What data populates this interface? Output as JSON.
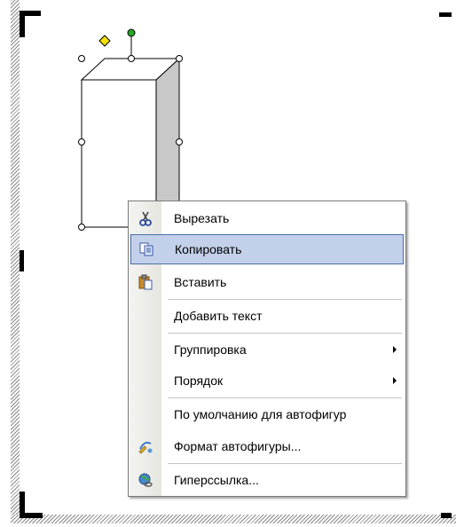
{
  "menu": {
    "items": [
      {
        "label": "Вырезать",
        "icon": "scissors-icon"
      },
      {
        "label": "Копировать",
        "icon": "copy-icon"
      },
      {
        "label": "Вставить",
        "icon": "paste-icon"
      },
      {
        "label": "Добавить текст"
      },
      {
        "label": "Группировка",
        "submenu": true
      },
      {
        "label": "Порядок",
        "submenu": true
      },
      {
        "label": "По умолчанию для автофигур"
      },
      {
        "label": "Формат автофигуры...",
        "icon": "format-shape-icon"
      },
      {
        "label": "Гиперссылка...",
        "icon": "hyperlink-globe-icon"
      }
    ],
    "highlighted_item": "Копировать"
  },
  "colors": {
    "highlight_fill": "#c3d0ea",
    "highlight_border": "#4a6ea9",
    "cube_side": "#c8c8c8",
    "rotation_handle": "#22aa22",
    "adjust_handle": "#f5e000"
  }
}
